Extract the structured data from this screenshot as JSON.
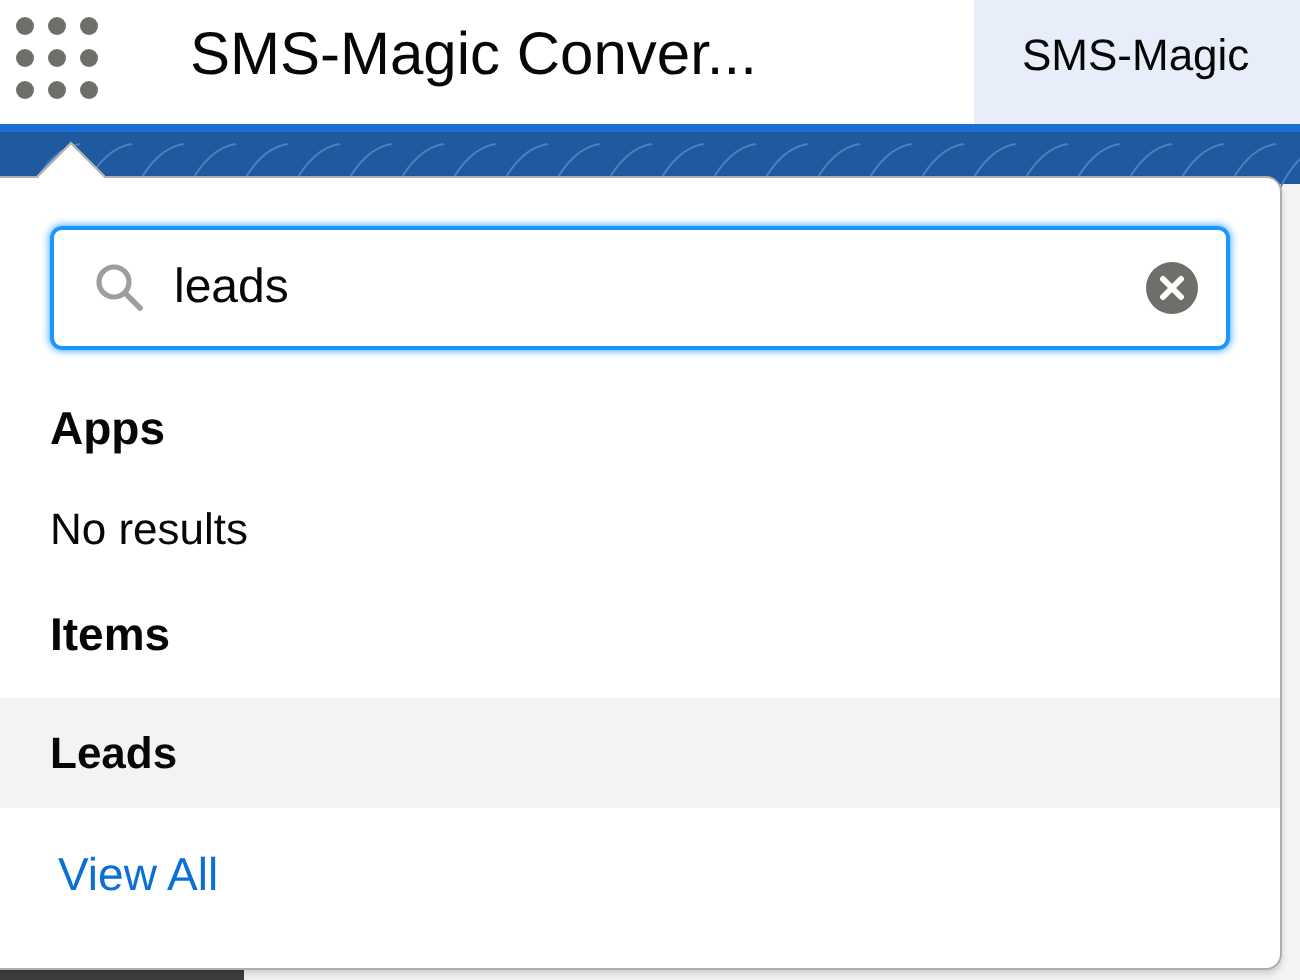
{
  "header": {
    "app_title": "SMS-Magic Conver...",
    "tabs": [
      {
        "label": "SMS-Magic",
        "selected": true
      }
    ]
  },
  "launcher_popup": {
    "search": {
      "value": "leads"
    },
    "sections": [
      {
        "heading": "Apps",
        "empty_text": "No results"
      },
      {
        "heading": "Items",
        "items": [
          {
            "label": "Leads",
            "selected": true
          }
        ]
      }
    ],
    "view_all": "View All"
  }
}
